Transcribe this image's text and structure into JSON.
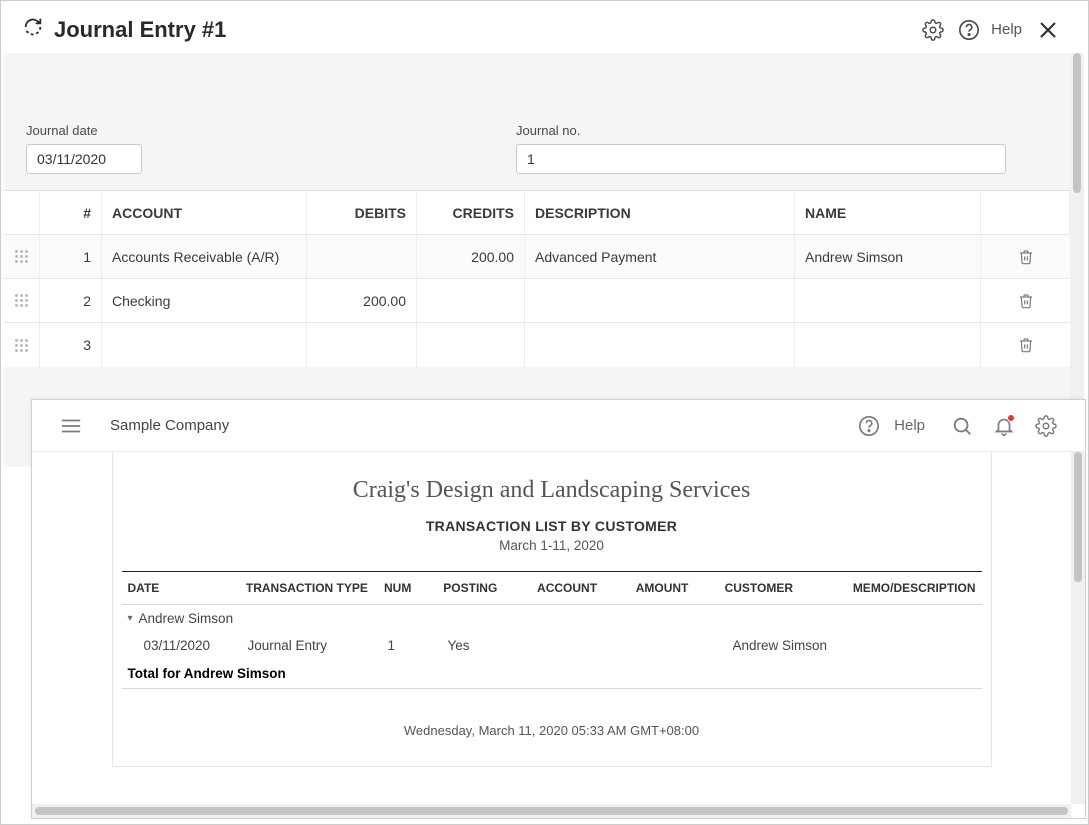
{
  "journal": {
    "title": "Journal Entry #1",
    "help_label": "Help",
    "meta": {
      "date_label": "Journal date",
      "date_value": "03/11/2020",
      "no_label": "Journal no.",
      "no_value": "1"
    },
    "columns": {
      "num": "#",
      "account": "ACCOUNT",
      "debits": "DEBITS",
      "credits": "CREDITS",
      "description": "DESCRIPTION",
      "name": "NAME"
    },
    "rows": [
      {
        "num": "1",
        "account": "Accounts Receivable (A/R)",
        "debits": "",
        "credits": "200.00",
        "description": "Advanced Payment",
        "name": "Andrew Simson"
      },
      {
        "num": "2",
        "account": "Checking",
        "debits": "200.00",
        "credits": "",
        "description": "",
        "name": ""
      },
      {
        "num": "3",
        "account": "",
        "debits": "",
        "credits": "",
        "description": "",
        "name": ""
      }
    ]
  },
  "report": {
    "company_nav": "Sample Company",
    "help_label": "Help",
    "company_title": "Craig's Design and Landscaping Services",
    "report_type": "TRANSACTION LIST BY CUSTOMER",
    "date_range": "March 1-11, 2020",
    "columns": {
      "date": "DATE",
      "ttype": "TRANSACTION TYPE",
      "num": "NUM",
      "posting": "POSTING",
      "account": "ACCOUNT",
      "amount": "AMOUNT",
      "customer": "CUSTOMER",
      "memo": "MEMO/DESCRIPTION"
    },
    "group_name": "Andrew Simson",
    "row": {
      "date": "03/11/2020",
      "ttype": "Journal Entry",
      "num": "1",
      "posting": "Yes",
      "account": "",
      "amount": "",
      "customer": "Andrew Simson",
      "memo": ""
    },
    "total_label": "Total for Andrew Simson",
    "footer_timestamp": "Wednesday, March 11, 2020  05:33 AM GMT+08:00"
  }
}
